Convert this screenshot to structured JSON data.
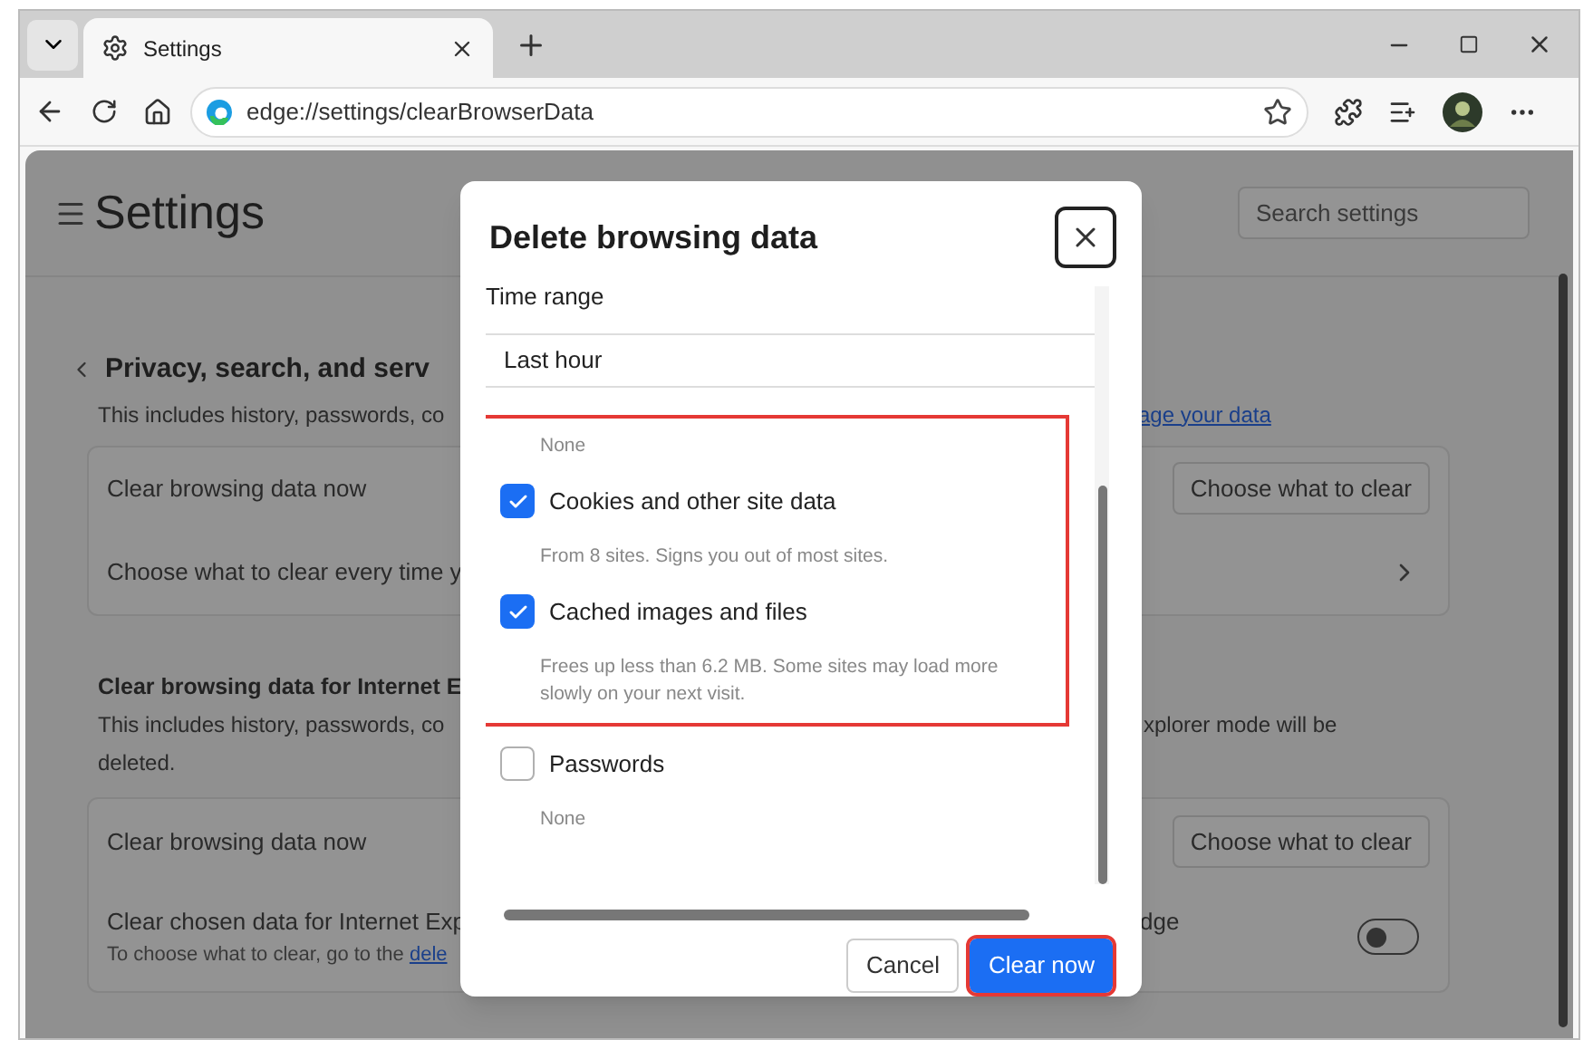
{
  "browser": {
    "tab": {
      "title": "Settings"
    },
    "address": "edge://settings/clearBrowserData"
  },
  "settings": {
    "title": "Settings",
    "search": {
      "placeholder": "Search settings"
    },
    "section": {
      "title": "Privacy, search, and serv",
      "description": "This includes history, passwords, co",
      "link": "age your data"
    },
    "card1": [
      {
        "kind": "button",
        "label": "Clear browsing data now",
        "button": "Choose what to clear"
      },
      {
        "kind": "chevron",
        "label": "Choose what to clear every time y"
      }
    ],
    "ie": {
      "title": "Clear browsing data for Internet E",
      "description": "This includes history, passwords, co",
      "description_right": "xplorer mode will be",
      "description_end": "deleted."
    },
    "card2": [
      {
        "kind": "button",
        "label": "Clear browsing data now",
        "button": "Choose what to clear"
      },
      {
        "kind": "toggle",
        "label": "Clear chosen data for Internet Exp",
        "label_right": "dge",
        "note": "To choose what to clear, go to the",
        "note_link": "dele",
        "on": false
      }
    ]
  },
  "dialog": {
    "title": "Delete browsing data",
    "time_range_label": "Time range",
    "time_range": "Last hour",
    "groups": [
      {
        "highlighted": true,
        "items": [
          {
            "kind": "description",
            "text": "None"
          },
          {
            "kind": "checkbox",
            "label": "Cookies and other site data",
            "checked": true
          },
          {
            "kind": "description",
            "text": "From 8 sites. Signs you out of most sites."
          },
          {
            "kind": "checkbox",
            "label": "Cached images and files",
            "checked": true
          },
          {
            "kind": "description",
            "text": "Frees up less than 6.2 MB. Some sites may load more slowly on your next visit."
          }
        ]
      },
      {
        "highlighted": false,
        "items": [
          {
            "kind": "checkbox",
            "label": "Passwords",
            "checked": false
          },
          {
            "kind": "description",
            "text": "None"
          }
        ]
      }
    ],
    "buttons": [
      {
        "label": "Cancel",
        "primary": false,
        "highlighted": false
      },
      {
        "label": "Clear now",
        "primary": true,
        "highlighted": true
      }
    ]
  }
}
